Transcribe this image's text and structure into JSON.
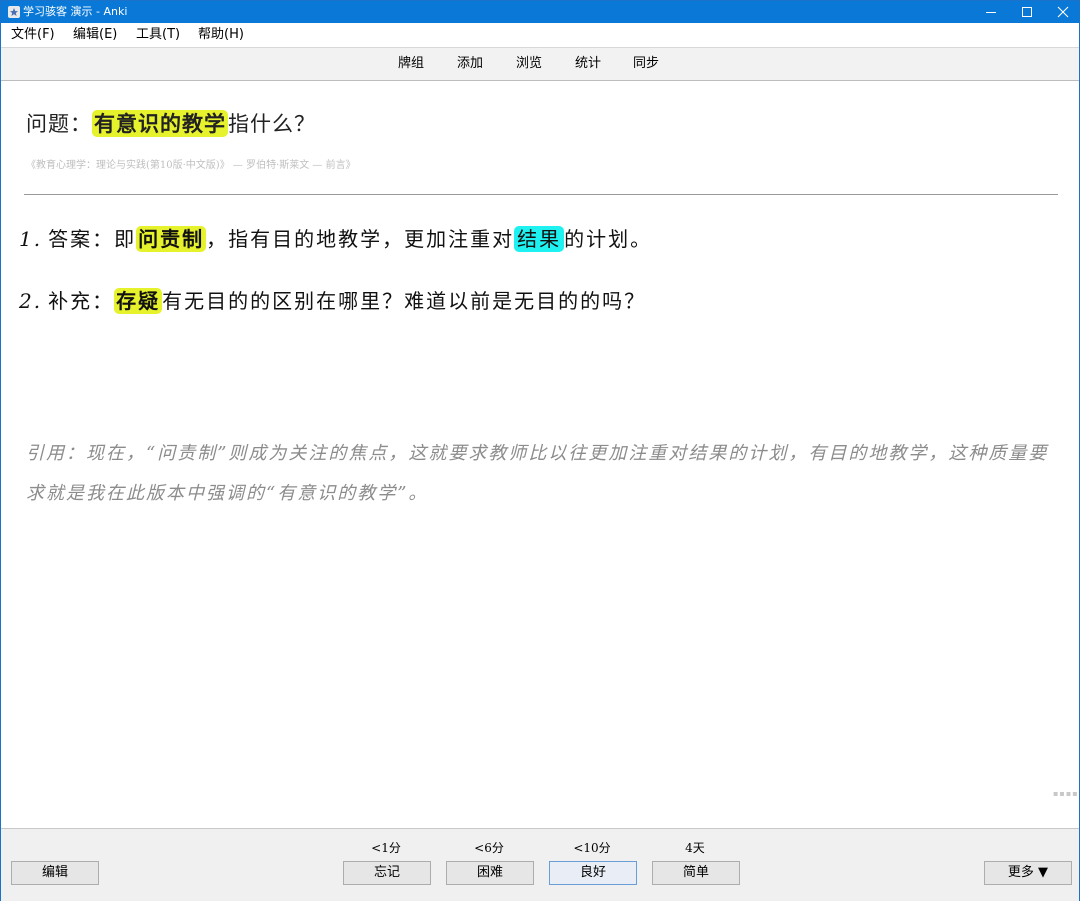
{
  "window": {
    "title": "学习骇客 演示 - Anki"
  },
  "menu": [
    "文件(F)",
    "编辑(E)",
    "工具(T)",
    "帮助(H)"
  ],
  "toolbar": [
    "牌组",
    "添加",
    "浏览",
    "统计",
    "同步"
  ],
  "card": {
    "question": {
      "prefix": "问题：",
      "highlight": "有意识的教学",
      "suffix": "指什么？"
    },
    "source": "《教育心理学：理论与实践(第10版·中文版)》 — 罗伯特·斯莱文 — 前言》",
    "answer1": {
      "num": "1.",
      "a": "答案：即",
      "hl1": "问责制",
      "b": "，指有目的地教学，更加注重对",
      "hl2": "结果",
      "c": "的计划。"
    },
    "answer2": {
      "num": "2.",
      "a": "补充：",
      "hl1": "存疑",
      "b": "有无目的的区别在哪里？难道以前是无目的的吗？"
    },
    "quote": "引用：现在，“问责制”则成为关注的焦点，这就要求教师比以往更加注重对结果的计划，有目的地教学，这种质量要求就是我在此版本中强调的“有意识的教学”。",
    "colors": {
      "highlight_yellow": "#e6f22c",
      "highlight_cyan": "#1ff0f0"
    }
  },
  "bottom": {
    "edit": "编辑",
    "intervals": [
      "<1分",
      "<6分",
      "<10分",
      "4天"
    ],
    "answers": [
      "忘记",
      "困难",
      "良好",
      "简单"
    ],
    "more": "更多 ▼"
  }
}
